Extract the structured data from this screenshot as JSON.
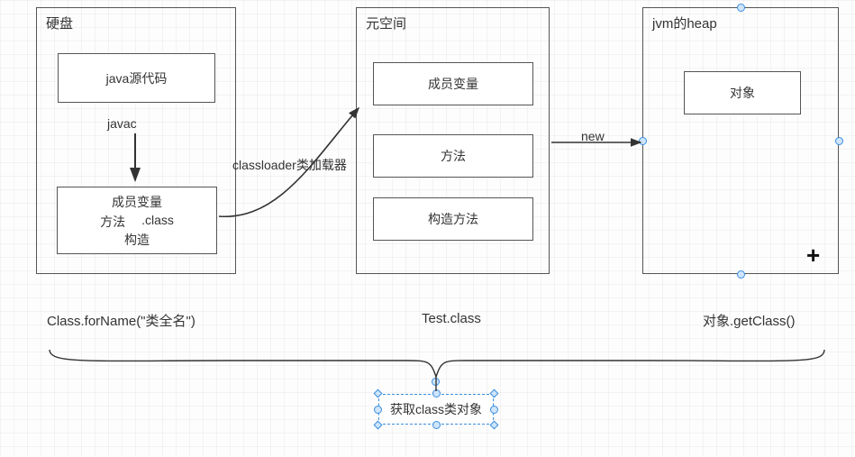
{
  "panel1": {
    "title": "硬盘",
    "box1": "java源代码",
    "javac": "javac",
    "box2_l1": "成员变量",
    "box2_l2a": "方法",
    "box2_l2b": ".class",
    "box2_l3": "构造",
    "caption": "Class.forName(\"类全名\")"
  },
  "panel2": {
    "title": "元空间",
    "box1": "成员变量",
    "box2": "方法",
    "box3": "构造方法",
    "caption": "Test.class"
  },
  "panel3": {
    "title": "jvm的heap",
    "box1": "对象",
    "caption": "对象.getClass()"
  },
  "labels": {
    "classloader": "classloader类加载器",
    "new": "new"
  },
  "bottom": {
    "text": "获取class类对象"
  }
}
